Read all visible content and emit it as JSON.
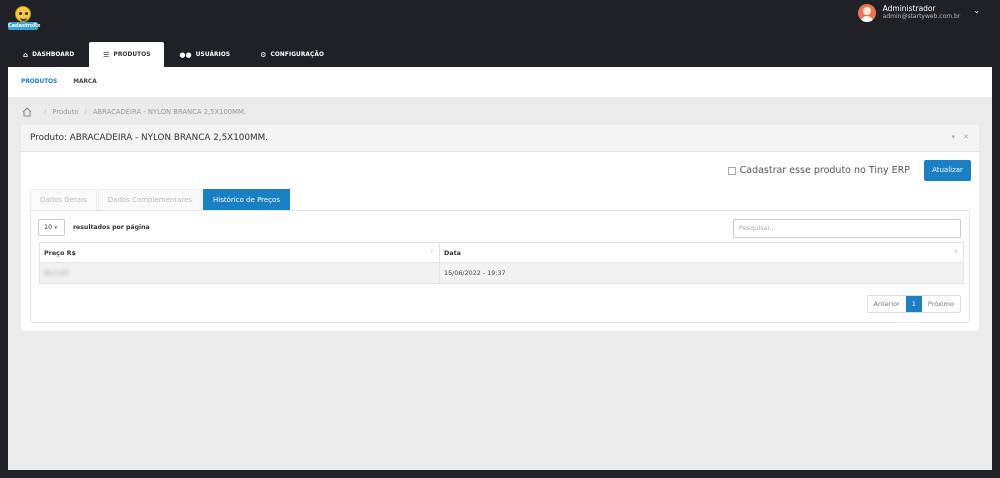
{
  "brand": {
    "logo_text": "CadastroRx"
  },
  "user": {
    "name": "Administrador",
    "email": "admin@startyweb.com.br"
  },
  "nav": {
    "items": [
      {
        "icon": "⌂",
        "label": "DASHBOARD"
      },
      {
        "icon": "☰",
        "label": "PRODUTOS"
      },
      {
        "icon": "👥",
        "label": "USUÁRIOS"
      },
      {
        "icon": "⚙",
        "label": "CONFIGURAÇÃO"
      }
    ]
  },
  "subnav": {
    "items": [
      "PRODUTOS",
      "MARCA"
    ]
  },
  "breadcrumb": {
    "items": [
      "Produto",
      "ABRACADEIRA - NYLON BRANCA 2,5X100MM."
    ]
  },
  "panel": {
    "title": "Produto: ABRACADEIRA - NYLON BRANCA 2,5X100MM.",
    "tiny_label": "Cadastrar esse produto no Tiny ERP",
    "update_button": "Atualizar"
  },
  "tabs": [
    "Dados Gerais",
    "Dados Complementares",
    "Histórico de Preços"
  ],
  "datatable": {
    "length_value": "10",
    "length_label": "resultados por página",
    "search_placeholder": "Pesquisar...",
    "columns": [
      "Preço R$",
      "Data"
    ],
    "rows": [
      {
        "price": "R$ 0,00",
        "date": "15/06/2022 - 19:37"
      }
    ],
    "pager": {
      "prev": "Anterior",
      "current": "1",
      "next": "Próximo"
    }
  },
  "colors": {
    "accent": "#1b7fc4",
    "topbar": "#1f2126"
  }
}
